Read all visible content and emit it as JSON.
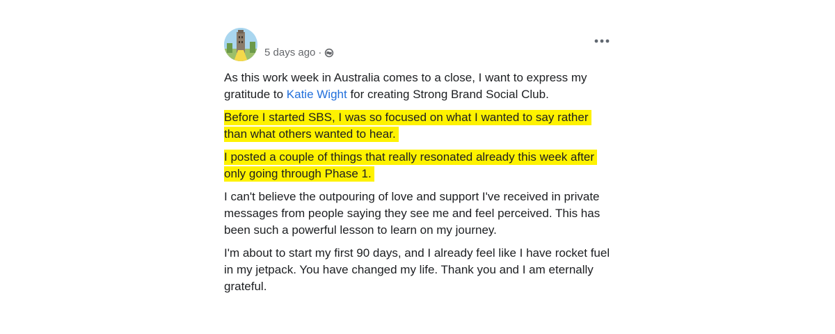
{
  "post": {
    "timestamp": "5 days ago",
    "separator": "·",
    "privacy_icon": "globe-icon",
    "more_icon": "more-options-icon",
    "para1_before": "As this work week in Australia comes to a close, I want to express my gratitude to ",
    "para1_link": "Katie Wight",
    "para1_after": " for creating Strong Brand Social Club.",
    "highlight1": "Before I started SBS, I was so focused on what I wanted to say rather than what others wanted to hear.",
    "highlight2": "I posted a couple of things that really resonated already this week after only going through Phase 1.",
    "para4": "I can't believe the outpouring of love and support I've received in private messages from people saying they see me and feel perceived.  This has been such a powerful lesson to learn on my journey.",
    "para5": "I'm about to start my first 90 days, and I already feel like I have rocket fuel in my jetpack.  You have changed my life.  Thank you and I am eternally grateful."
  },
  "colors": {
    "highlight": "#fef200",
    "link": "#216fdb",
    "meta_text": "#65676b",
    "body_text": "#1c1e21"
  }
}
